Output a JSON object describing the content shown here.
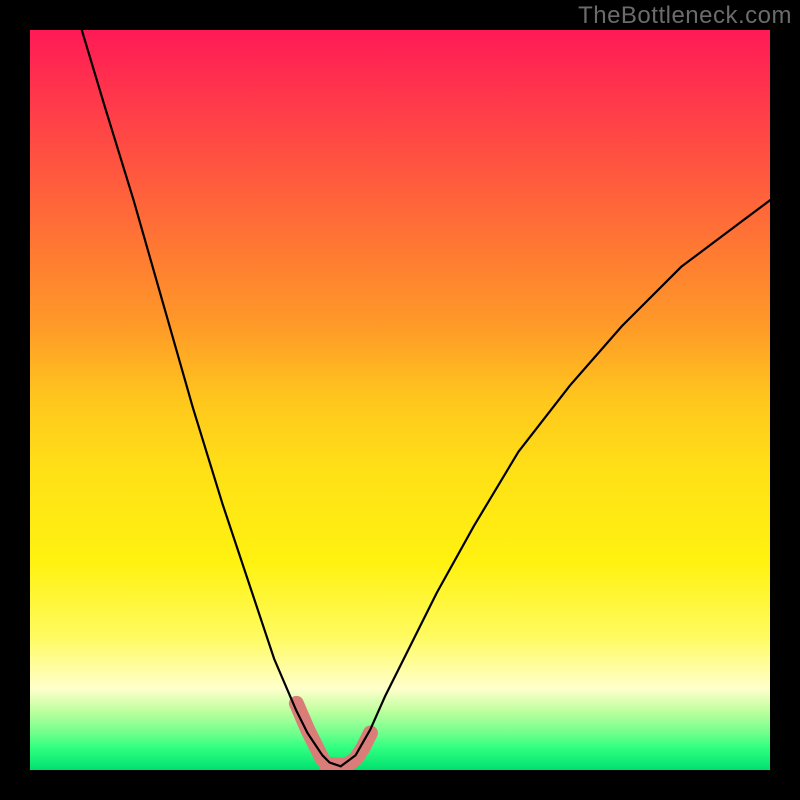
{
  "watermark": "TheBottleneck.com",
  "chart_data": {
    "type": "line",
    "title": "",
    "xlabel": "",
    "ylabel": "",
    "xlim": [
      0,
      100
    ],
    "ylim": [
      0,
      100
    ],
    "grid": false,
    "legend": false,
    "background_gradient": [
      "#ff1a56",
      "#ff9a28",
      "#ffe116",
      "#fffb60",
      "#00e070"
    ],
    "series": [
      {
        "name": "left_curve",
        "x": [
          7,
          10,
          14,
          18,
          22,
          26,
          30,
          33,
          36,
          37.5,
          38.5,
          39.5,
          40.5,
          42
        ],
        "y": [
          100,
          90,
          77,
          63,
          49,
          36,
          24,
          15,
          8,
          5,
          3.5,
          2,
          1,
          0.5
        ]
      },
      {
        "name": "right_curve",
        "x": [
          42,
          44,
          46,
          48,
          51,
          55,
          60,
          66,
          73,
          80,
          88,
          96,
          100
        ],
        "y": [
          0.5,
          2,
          5.5,
          10,
          16,
          24,
          33,
          43,
          52,
          60,
          68,
          74,
          77
        ]
      },
      {
        "name": "highlight_segment_left",
        "x": [
          36,
          37.5,
          38.5,
          39.5
        ],
        "y": [
          9,
          5.5,
          3.5,
          1.5
        ]
      },
      {
        "name": "highlight_segment_bottom",
        "x": [
          40,
          41,
          42,
          43,
          44,
          45,
          46
        ],
        "y": [
          0.8,
          0.7,
          0.6,
          0.8,
          1.5,
          3,
          5
        ]
      }
    ],
    "annotations": []
  }
}
